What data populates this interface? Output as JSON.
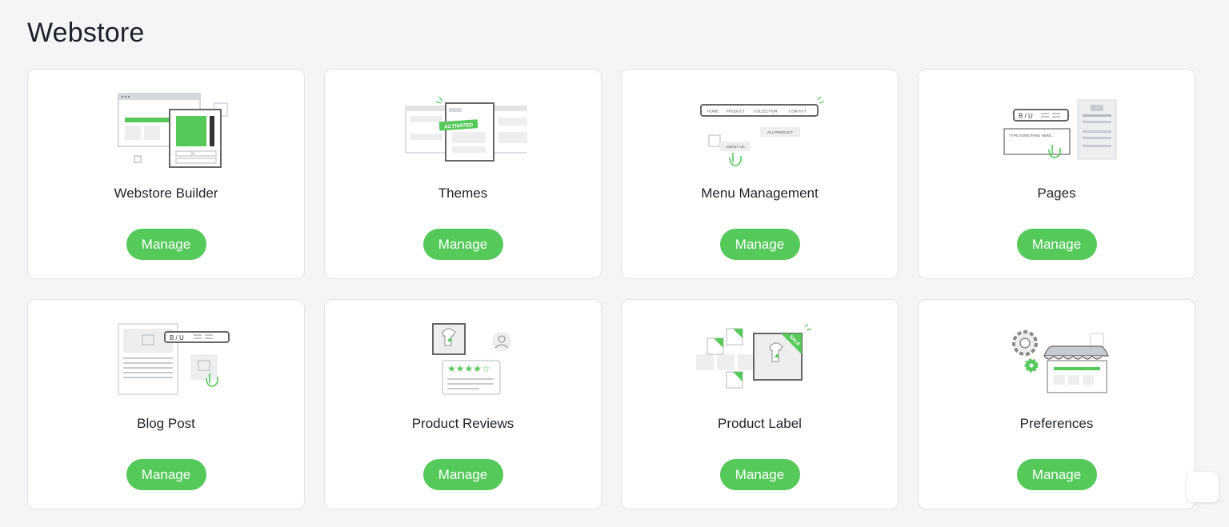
{
  "page": {
    "title": "Webstore"
  },
  "cards": [
    {
      "title": "Webstore Builder",
      "button": "Manage",
      "illustration": "webstore-builder-illustration"
    },
    {
      "title": "Themes",
      "button": "Manage",
      "illustration": "themes-illustration",
      "badge": "ACTIVATED"
    },
    {
      "title": "Menu Management",
      "button": "Manage",
      "illustration": "menu-management-illustration",
      "menu_items": [
        "HOME",
        "PRODUCT",
        "COLLECTION",
        "CONTACT"
      ],
      "submenu_a": "ALL PRODUCT",
      "submenu_b": "ABOUT US"
    },
    {
      "title": "Pages",
      "button": "Manage",
      "illustration": "pages-illustration",
      "toolbar": "B / U",
      "input_placeholder": "TYPE SOMETHING HERE..."
    },
    {
      "title": "Blog Post",
      "button": "Manage",
      "illustration": "blog-post-illustration",
      "toolbar": "B / U"
    },
    {
      "title": "Product Reviews",
      "button": "Manage",
      "illustration": "product-reviews-illustration",
      "stars": "★★★★☆"
    },
    {
      "title": "Product Label",
      "button": "Manage",
      "illustration": "product-label-illustration",
      "label_text": "SALE"
    },
    {
      "title": "Preferences",
      "button": "Manage",
      "illustration": "preferences-illustration"
    }
  ],
  "colors": {
    "accent": "#55c95a",
    "background": "#f4f5f7",
    "card": "#ffffff",
    "illustration_gray": "#9aa0a6"
  }
}
